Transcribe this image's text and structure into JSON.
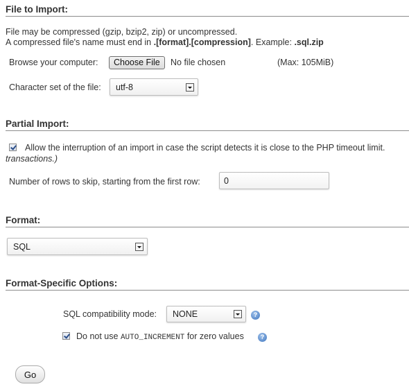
{
  "file_to_import": {
    "heading": "File to Import:",
    "note_line1": "File may be compressed (gzip, bzip2, zip) or uncompressed.",
    "note_line2_prefix": "A compressed file's name must end in ",
    "note_line2_bold": ".[format].[compression]",
    "note_line2_mid": ". Example: ",
    "note_line2_example": ".sql.zip",
    "browse_label": "Browse your computer:",
    "choose_file_button": "Choose File",
    "no_file_text": "No file chosen",
    "max_size": "(Max: 105MiB)",
    "charset_label": "Character set of the file:",
    "charset_value": "utf-8"
  },
  "partial_import": {
    "heading": "Partial Import:",
    "allow_interrupt_checked": true,
    "allow_interrupt_label": "Allow the interruption of an import in case the script detects it is close to the PHP timeout limit.",
    "allow_interrupt_note": "transactions.)",
    "skip_rows_label": "Number of rows to skip, starting from the first row:",
    "skip_rows_value": "0"
  },
  "format": {
    "heading": "Format:",
    "selected": "SQL"
  },
  "format_options": {
    "heading": "Format-Specific Options:",
    "compat_label": "SQL compatibility mode:",
    "compat_value": "NONE",
    "no_auto_inc_checked": true,
    "no_auto_inc_prefix": "Do not use ",
    "no_auto_inc_code": "AUTO_INCREMENT",
    "no_auto_inc_suffix": " for zero values",
    "help_icon_glyph": "?"
  },
  "actions": {
    "go_button": "Go"
  }
}
